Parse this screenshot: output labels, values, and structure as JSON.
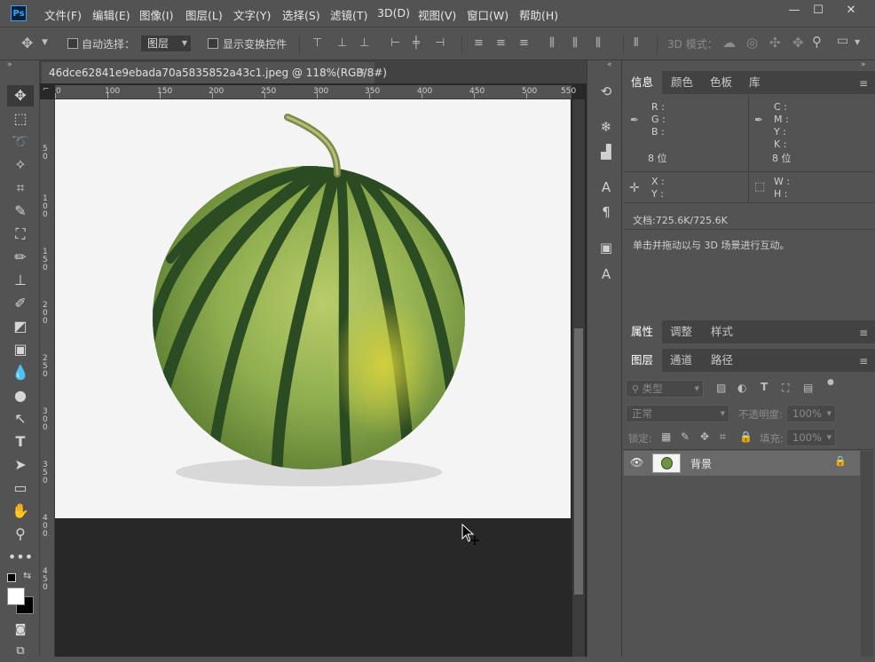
{
  "app": {
    "logo_text": "Ps"
  },
  "menu": [
    "文件(F)",
    "编辑(E)",
    "图像(I)",
    "图层(L)",
    "文字(Y)",
    "选择(S)",
    "滤镜(T)",
    "3D(D)",
    "视图(V)",
    "窗口(W)",
    "帮助(H)"
  ],
  "window_controls": {
    "minimize": "—",
    "restore": "☐",
    "close": "✕"
  },
  "options": {
    "auto_select_label": "自动选择：",
    "auto_select_target": "图层",
    "show_transform_label": "显示变换控件",
    "mode_3d_label": "3D 模式："
  },
  "document": {
    "tab_title": "46dce62841e9ebada70a5835852a43c1.jpeg @ 118%(RGB/8#)",
    "tab_close": "✕"
  },
  "ruler": {
    "h_ticks": [
      "0",
      "100",
      "150",
      "200",
      "250",
      "300",
      "350",
      "400",
      "450",
      "500",
      "550"
    ],
    "v_ticks": [
      "5\n0",
      "1\n0\n0",
      "1\n5\n0",
      "2\n0\n0",
      "2\n5\n0",
      "3\n0\n0",
      "3\n5\n0",
      "4\n0\n0",
      "4\n5\n0"
    ]
  },
  "info_panel": {
    "tabs": [
      "信息",
      "颜色",
      "色板",
      "库"
    ],
    "rgb_labels": [
      "R :",
      "G :",
      "B :"
    ],
    "cmyk_labels": [
      "C :",
      "M :",
      "Y :",
      "K :"
    ],
    "bit_left": "8 位",
    "bit_right": "8 位",
    "xy_labels": [
      "X :",
      "Y :"
    ],
    "wh_labels": [
      "W :",
      "H :"
    ],
    "doc_size": "文档:725.6K/725.6K",
    "hint": "单击并拖动以与 3D 场景进行互动。"
  },
  "props_panel": {
    "tabs": [
      "属性",
      "调整",
      "样式"
    ]
  },
  "layers_panel": {
    "tabs": [
      "图层",
      "通道",
      "路径"
    ],
    "filter_label": "类型",
    "blend_mode": "正常",
    "opacity_label": "不透明度:",
    "opacity_value": "100%",
    "lock_label": "锁定:",
    "fill_label": "填充:",
    "fill_value": "100%",
    "layers": [
      {
        "name": "背景",
        "visible": true,
        "locked": true
      }
    ]
  }
}
